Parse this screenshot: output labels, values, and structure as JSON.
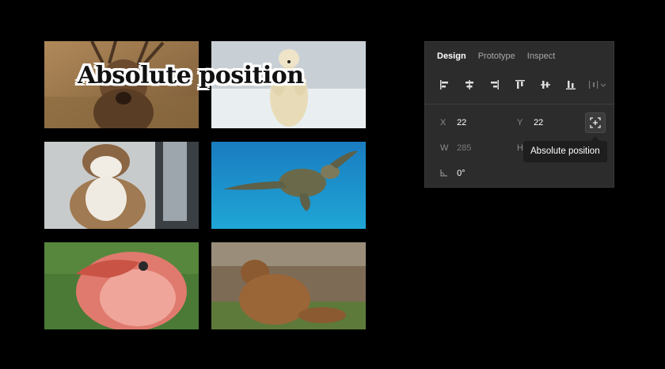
{
  "canvas": {
    "overlay_text": "Absolute position",
    "photos": [
      {
        "subject": "deer"
      },
      {
        "subject": "polar bear"
      },
      {
        "subject": "cat"
      },
      {
        "subject": "sea turtle"
      },
      {
        "subject": "flamingo"
      },
      {
        "subject": "brown bear"
      }
    ]
  },
  "panel": {
    "tabs": [
      {
        "label": "Design",
        "active": true
      },
      {
        "label": "Prototype",
        "active": false
      },
      {
        "label": "Inspect",
        "active": false
      }
    ],
    "align_icons": [
      "align-left-icon",
      "align-horizontal-center-icon",
      "align-right-icon",
      "align-top-icon",
      "align-vertical-center-icon",
      "align-bottom-icon",
      "distribute-icon"
    ],
    "fields": {
      "x_label": "X",
      "x_value": "22",
      "y_label": "Y",
      "y_value": "22",
      "w_label": "W",
      "w_value": "285",
      "h_label": "H",
      "rotation_value": "0°"
    },
    "tooltip": "Absolute position"
  },
  "colors": {
    "background": "#000000",
    "panel": "#2c2c2c",
    "tooltip": "#1e1e1e"
  }
}
